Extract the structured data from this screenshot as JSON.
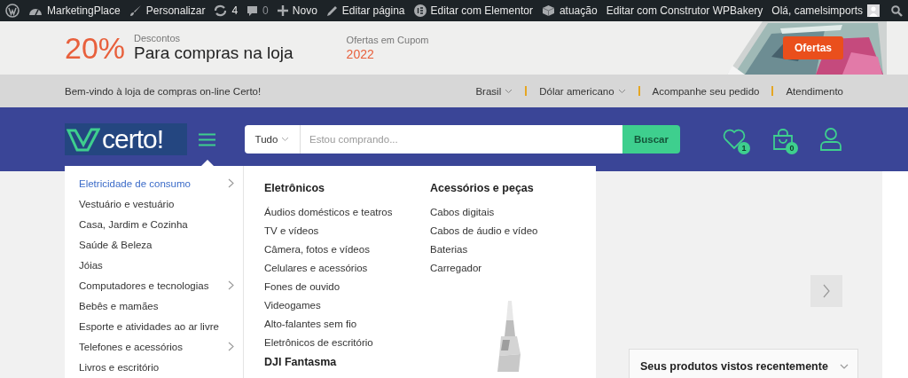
{
  "admin_bar": {
    "items": [
      {
        "kind": "wordpress"
      },
      {
        "kind": "site",
        "label": "MarketingPlace"
      },
      {
        "kind": "customize",
        "label": "Personalizar"
      },
      {
        "kind": "updates",
        "label": "4"
      },
      {
        "kind": "comments",
        "label": "0"
      },
      {
        "kind": "new",
        "label": "Novo"
      },
      {
        "kind": "edit",
        "label": "Editar página"
      },
      {
        "kind": "elementor",
        "label": "Editar com Elementor"
      },
      {
        "kind": "cube",
        "label": "atuação"
      },
      {
        "kind": "text",
        "label": "Editar com Construtor WPBakery"
      }
    ],
    "greeting": "Olá, camelsimports"
  },
  "promo": {
    "percent": "20%",
    "caption": "Descontos",
    "headline": "Para compras na loja",
    "coupon_label": "Ofertas em Cupom",
    "coupon_year": "2022",
    "button": "Ofertas"
  },
  "topbar": {
    "welcome": "Bem-vindo à loja de compras on-line Certo!",
    "links": [
      {
        "label": "Brasil",
        "dropdown": true
      },
      {
        "label": "Dólar americano",
        "dropdown": true
      },
      {
        "label": "Acompanhe seu pedido",
        "dropdown": false
      },
      {
        "label": "Atendimento",
        "dropdown": false
      }
    ]
  },
  "header": {
    "logo": "certo!",
    "search": {
      "category": "Tudo",
      "placeholder": "Estou comprando...",
      "button": "Buscar"
    },
    "wishlist_count": "1",
    "cart_count": "0"
  },
  "menu": {
    "categories": [
      {
        "label": "Eletricidade de consumo",
        "selected": true,
        "has_submenu": true
      },
      {
        "label": "Vestuário e vestuário",
        "selected": false,
        "has_submenu": false
      },
      {
        "label": "Casa, Jardim e Cozinha",
        "selected": false,
        "has_submenu": false
      },
      {
        "label": "Saúde & Beleza",
        "selected": false,
        "has_submenu": false
      },
      {
        "label": "Jóias",
        "selected": false,
        "has_submenu": false
      },
      {
        "label": "Computadores e tecnologias",
        "selected": false,
        "has_submenu": true
      },
      {
        "label": "Bebês e mamães",
        "selected": false,
        "has_submenu": false
      },
      {
        "label": "Esporte e atividades ao ar livre",
        "selected": false,
        "has_submenu": false
      },
      {
        "label": "Telefones e acessórios",
        "selected": false,
        "has_submenu": true
      },
      {
        "label": "Livros e escritório",
        "selected": false,
        "has_submenu": false
      }
    ],
    "columns": [
      {
        "sections": [
          {
            "title": "Eletrônicos",
            "items": [
              "Áudios domésticos e teatros",
              "TV e vídeos",
              "Câmera, fotos e vídeos",
              "Celulares e acessórios",
              "Fones de ouvido",
              "Videogames",
              "Alto-falantes sem fio",
              "Eletrônicos de escritório"
            ]
          },
          {
            "title": "DJI Fantasma"
          }
        ]
      },
      {
        "sections": [
          {
            "title": "Acessórios e peças",
            "items": [
              "Cabos digitais",
              "Cabos de áudio e vídeo",
              "Baterias",
              "Carregador"
            ]
          }
        ]
      }
    ]
  },
  "recently_viewed": {
    "title": "Seus produtos vistos recentemente"
  }
}
